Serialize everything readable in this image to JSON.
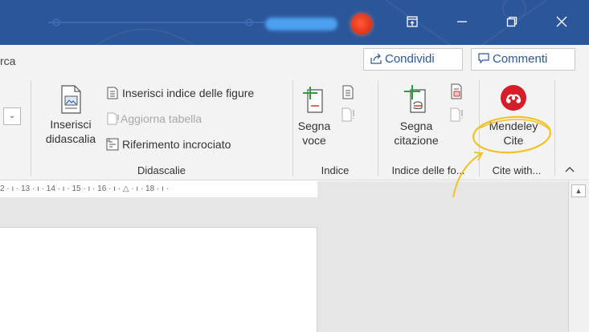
{
  "search": {
    "text": "rca"
  },
  "share": {
    "label": "Condividi"
  },
  "comments": {
    "label": "Commenti"
  },
  "ribbon": {
    "didascalie": {
      "insert_caption": {
        "line1": "Inserisci",
        "line2": "didascalia"
      },
      "insert_figures_index": "Inserisci indice delle figure",
      "update_table": "Aggiorna tabella",
      "cross_reference": "Riferimento incrociato",
      "label": "Didascalie"
    },
    "indice": {
      "mark_entry": {
        "line1": "Segna",
        "line2": "voce"
      },
      "label": "Indice"
    },
    "citations": {
      "mark_citation": {
        "line1": "Segna",
        "line2": "citazione"
      },
      "label": "Indice delle fo..."
    },
    "mendeley": {
      "button": {
        "line1": "Mendeley",
        "line2": "Cite"
      },
      "label": "Cite with..."
    }
  },
  "ruler": {
    "text": "2 · ı · 13 · ı · 14 · ı · 15 · ı · 16 · ı · △ · ı · 18 · ı ·"
  },
  "colors": {
    "titlebar": "#2b579a",
    "accent": "#2b579a",
    "mendeley": "#d51e2a",
    "annotation": "#f0c22a"
  },
  "icons": [
    "restore-ribbon-icon",
    "minimize-icon",
    "maximize-icon",
    "close-icon",
    "share-icon",
    "comment-icon",
    "mendeley-icon"
  ]
}
